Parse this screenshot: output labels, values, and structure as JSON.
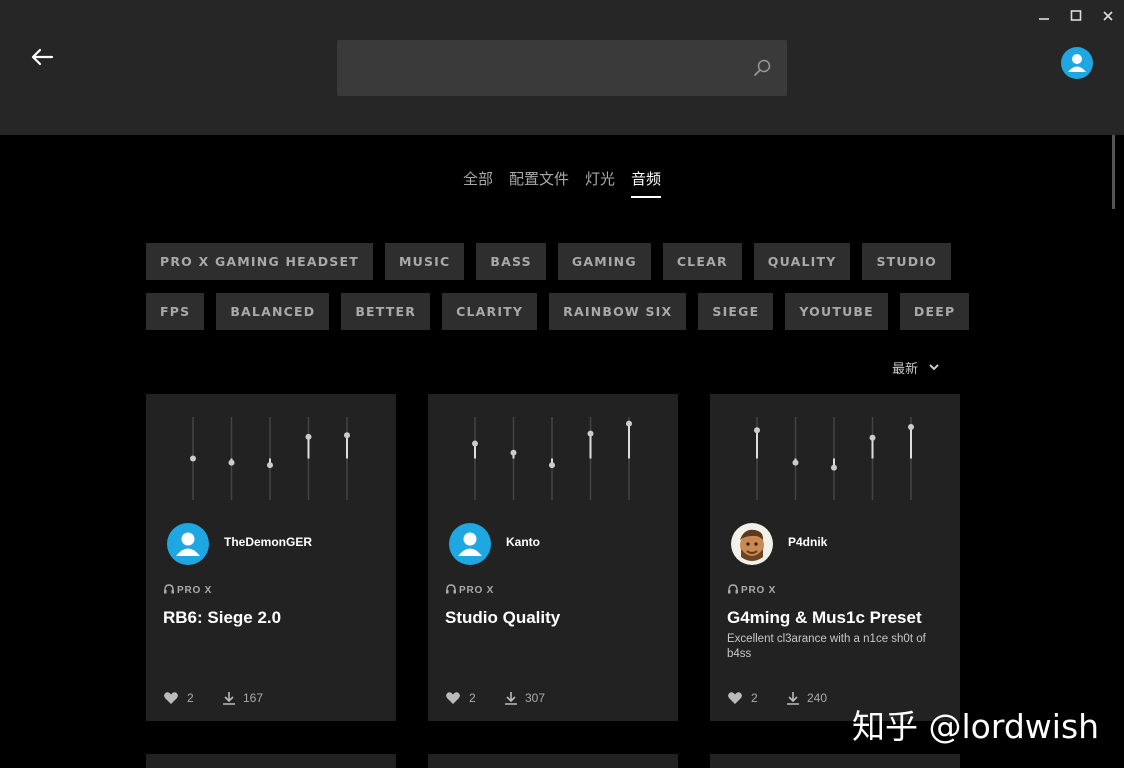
{
  "search": {
    "placeholder": "",
    "value": ""
  },
  "tabs": [
    {
      "label": "全部",
      "active": false
    },
    {
      "label": "配置文件",
      "active": false
    },
    {
      "label": "灯光",
      "active": false
    },
    {
      "label": "音频",
      "active": true
    }
  ],
  "tags": {
    "row1": [
      "PRO X GAMING HEADSET",
      "MUSIC",
      "BASS",
      "GAMING",
      "CLEAR",
      "QUALITY",
      "STUDIO"
    ],
    "row2": [
      "FPS",
      "BALANCED",
      "BETTER",
      "CLARITY",
      "RAINBOW SIX",
      "SIEGE",
      "YOUTUBE",
      "DEEP"
    ]
  },
  "sort": {
    "label": "最新"
  },
  "cards": [
    {
      "username": "TheDemonGER",
      "device": "PRO X",
      "title": "RB6: Siege 2.0",
      "description": "",
      "likes": "2",
      "downloads": "167",
      "eq_levels": [
        0.5,
        0.45,
        0.42,
        0.76,
        0.78
      ],
      "avatar": "default"
    },
    {
      "username": "Kanto",
      "device": "PRO X",
      "title": "Studio Quality",
      "description": "",
      "likes": "2",
      "downloads": "307",
      "eq_levels": [
        0.68,
        0.57,
        0.42,
        0.8,
        0.92
      ],
      "avatar": "default"
    },
    {
      "username": "P4dnik",
      "device": "PRO X",
      "title": "G4ming & Mus1c Preset",
      "description": "Excellent cl3arance with a n1ce sh0t of b4ss",
      "likes": "2",
      "downloads": "240",
      "eq_levels": [
        0.84,
        0.45,
        0.39,
        0.75,
        0.88
      ],
      "avatar": "photo"
    }
  ],
  "colors": {
    "accent": "#1ea7e0",
    "topbar": "#262626",
    "card": "#222222",
    "tag": "#2e2e2e"
  },
  "watermark": "知乎 @lordwish"
}
